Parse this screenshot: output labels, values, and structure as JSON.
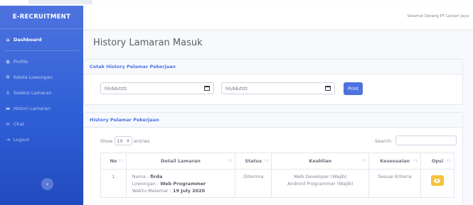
{
  "sidebar": {
    "brand": "E-RECRUITMENT",
    "items": [
      {
        "icon": "home-icon",
        "glyph": "⌂",
        "label": "Dashboard"
      },
      {
        "icon": "profile-icon",
        "glyph": "◉",
        "label": "Profile"
      },
      {
        "icon": "gear-icon",
        "glyph": "✻",
        "label": "Kelola Lowongan"
      },
      {
        "icon": "user-icon",
        "glyph": "♙",
        "label": "Seleksi Lamaran"
      },
      {
        "icon": "folder-icon",
        "glyph": "▬",
        "label": "Histori Lamaran"
      },
      {
        "icon": "chat-icon",
        "glyph": "≡",
        "label": "Chat"
      },
      {
        "icon": "logout-icon",
        "glyph": "⇥",
        "label": "Logout"
      }
    ],
    "toggle_glyph": "‹"
  },
  "topbar": {
    "welcome": "Selamat Datang PT Lestari Jaya"
  },
  "page": {
    "title": "History Lamaran Masuk"
  },
  "print_card": {
    "header": "Cetak History Pelamar Pekerjaan",
    "date_from_placeholder": "hh/bb/tttt",
    "date_to_placeholder": "hh/bb/tttt",
    "print_label": "Print"
  },
  "history_card": {
    "header": "History Pelamar Pekerjaan",
    "show_label": "Show",
    "entries_value": "10",
    "entries_label": "entries",
    "search_label": "Search:",
    "columns": [
      "No",
      "Detail Lamaran",
      "Status",
      "Keahlian",
      "Kesesuaian",
      "Opsi"
    ],
    "rows": [
      {
        "no": "1",
        "nama_label": "Nama :",
        "nama": "firda",
        "lowongan_label": "Lowongan :",
        "lowongan": "Web Programmer",
        "waktu_label": "Waktu Melamar :",
        "waktu": "19 July 2020",
        "status": "Diterima",
        "keahlian": [
          "Web Developer (Wajib)",
          "Android Programmer (Wajib)"
        ],
        "kesesuaian": "Sesuai Kriteria",
        "opsi_icon": "eye-icon"
      }
    ]
  }
}
